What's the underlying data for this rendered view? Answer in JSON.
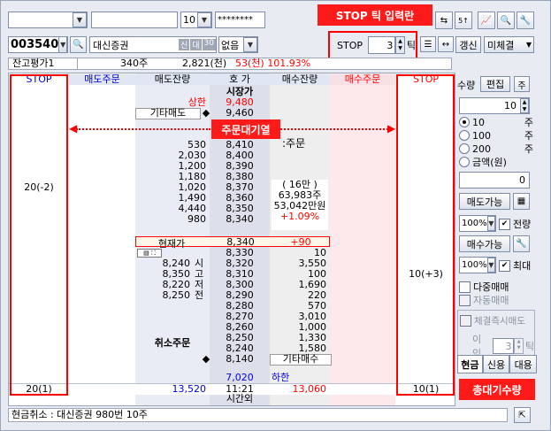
{
  "toolbar1": {
    "account_value": "",
    "password_value": "",
    "account_suffix": "10",
    "password_mask": "********",
    "stop_tick_callout": "STOP 틱 입력란"
  },
  "toolbar2": {
    "stock_code": "003540",
    "stock_name": "대신증권",
    "tag_credit": "신",
    "tag_loan": "대",
    "tag_30": "30",
    "condition_value": "없음",
    "stop_label": "STOP",
    "stop_tick_value": "3",
    "tick_unit": "틱",
    "refresh_label": "갱신",
    "unfilled_label": "미체결"
  },
  "balance_bar": {
    "label": "잔고평가1",
    "qty": "340주",
    "amount": "2,821(천)",
    "pnl": "53(천) 101.93%"
  },
  "grid": {
    "headers": [
      "STOP",
      "매도주문",
      "매도잔량",
      "호 가",
      "매수잔량",
      "매수주문",
      "STOP"
    ],
    "market_label": "시장가",
    "upper_limit_label": "상한",
    "upper_limit_price": "9,480",
    "other_sell_label": "기타매도",
    "other_sell_price": "9,460",
    "pending_callout": "주문대기열",
    "pending_text": ":주문",
    "sell_rows": [
      {
        "stop": "",
        "qty": "530",
        "price": "8,410"
      },
      {
        "stop": "",
        "qty": "2,030",
        "price": "8,400"
      },
      {
        "stop": "",
        "qty": "1,200",
        "price": "8,390"
      },
      {
        "stop": "",
        "qty": "1,180",
        "price": "8,380"
      },
      {
        "stop": "20(-2)",
        "qty": "1,020",
        "price": "8,370"
      },
      {
        "stop": "",
        "qty": "1,490",
        "price": "8,360"
      },
      {
        "stop": "",
        "qty": "4,440",
        "price": "8,350"
      },
      {
        "stop": "",
        "qty": "980",
        "price": "8,340"
      }
    ],
    "info_lines": [
      "( 16만 )",
      "63,983주",
      "53,042만원",
      "+1.09%"
    ],
    "current_label": "현재가",
    "current_price": "8,340",
    "current_change": "+90",
    "buy_rows": [
      {
        "price": "8,330",
        "qty": "10",
        "stop": ""
      },
      {
        "price": "8,320",
        "qty": "3,550",
        "stop": ""
      },
      {
        "price": "8,310",
        "qty": "100",
        "stop": "10(+3)"
      },
      {
        "price": "8,300",
        "qty": "1,690",
        "stop": ""
      },
      {
        "price": "8,290",
        "qty": "220",
        "stop": ""
      },
      {
        "price": "8,280",
        "qty": "570",
        "stop": ""
      },
      {
        "price": "8,270",
        "qty": "3,010",
        "stop": ""
      },
      {
        "price": "8,260",
        "qty": "1,000",
        "stop": ""
      },
      {
        "price": "8,250",
        "qty": "1,330",
        "stop": ""
      },
      {
        "price": "8,240",
        "qty": "1,580",
        "stop": ""
      },
      {
        "price": "8,140",
        "qty": "기타매수",
        "stop": ""
      }
    ],
    "ohlc": [
      {
        "price": "8,240",
        "label": "시"
      },
      {
        "price": "8,350",
        "label": "고"
      },
      {
        "price": "8,220",
        "label": "저"
      },
      {
        "price": "8,250",
        "label": "전"
      }
    ],
    "cancel_label": "취소주문",
    "lower_limit_price": "7,020",
    "lower_limit_label": "하한",
    "footer": {
      "sell_stop_total": "20(1)",
      "sell_total": "13,520",
      "time": "11:21",
      "buy_total": "13,060",
      "buy_stop_total": "10(1)"
    },
    "after_hours_label": "시간외"
  },
  "right_panel": {
    "qty_label": "수량",
    "edit_label": "편집",
    "qty_value": "10",
    "presets": [
      {
        "label": "10",
        "unit": "주",
        "checked": true
      },
      {
        "label": "100",
        "unit": "주",
        "checked": false
      },
      {
        "label": "200",
        "unit": "주",
        "checked": false
      },
      {
        "label": "금액(원)",
        "unit": "",
        "checked": false
      }
    ],
    "amount_value": "0",
    "sell_avail_label": "매도가능",
    "pct_value1": "100%",
    "all_qty_label": "전량",
    "buy_avail_label": "매수가능",
    "pct_value2": "100%",
    "max_label": "최대",
    "multi_order_label": "다중매매",
    "auto_trade_label": "자동매매",
    "instant_sell_label": "체결즉시매도",
    "profit_label": "이익",
    "profit_tick_value": "3",
    "profit_tick_unit": "틱",
    "tabs": [
      "현금",
      "신용",
      "대용"
    ],
    "total_qty_callout": "총대기수량"
  },
  "status_bar": {
    "text": "현금취소 : 대신증권 980번 10주"
  }
}
